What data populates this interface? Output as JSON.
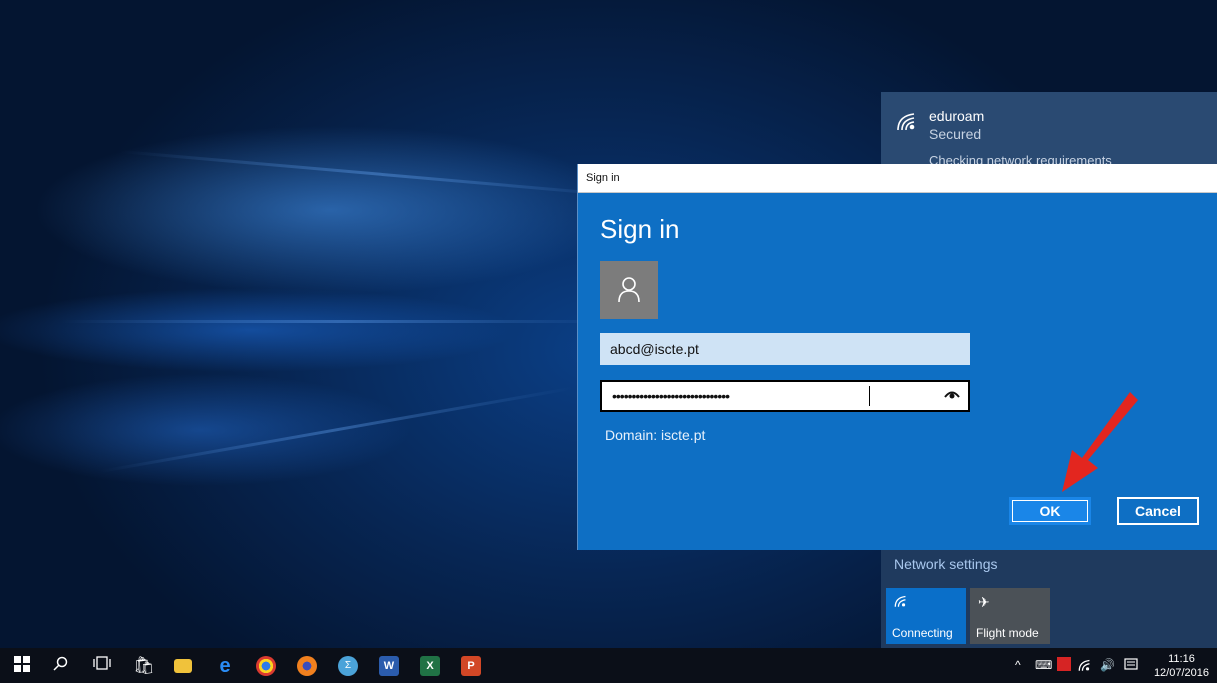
{
  "network": {
    "name": "eduroam",
    "status": "Secured",
    "checking": "Checking network requirements",
    "settings_label": "Network settings",
    "tiles": [
      {
        "label": "Connecting",
        "icon": "wifi-icon"
      },
      {
        "label": "Flight mode",
        "icon": "airplane-icon"
      }
    ]
  },
  "dialog": {
    "title": "Sign in",
    "heading": "Sign in",
    "username": "abcd@iscte.pt",
    "password_mask": "••••••••••••••••••••••••••••••",
    "domain": "Domain: iscte.pt",
    "ok_label": "OK",
    "cancel_label": "Cancel"
  },
  "taskbar": {
    "time": "11:16",
    "date": "12/07/2016"
  },
  "colors": {
    "dialog_bg": "#0e6fc4",
    "accent": "#1a86e8",
    "arrow": "#e3261f"
  }
}
